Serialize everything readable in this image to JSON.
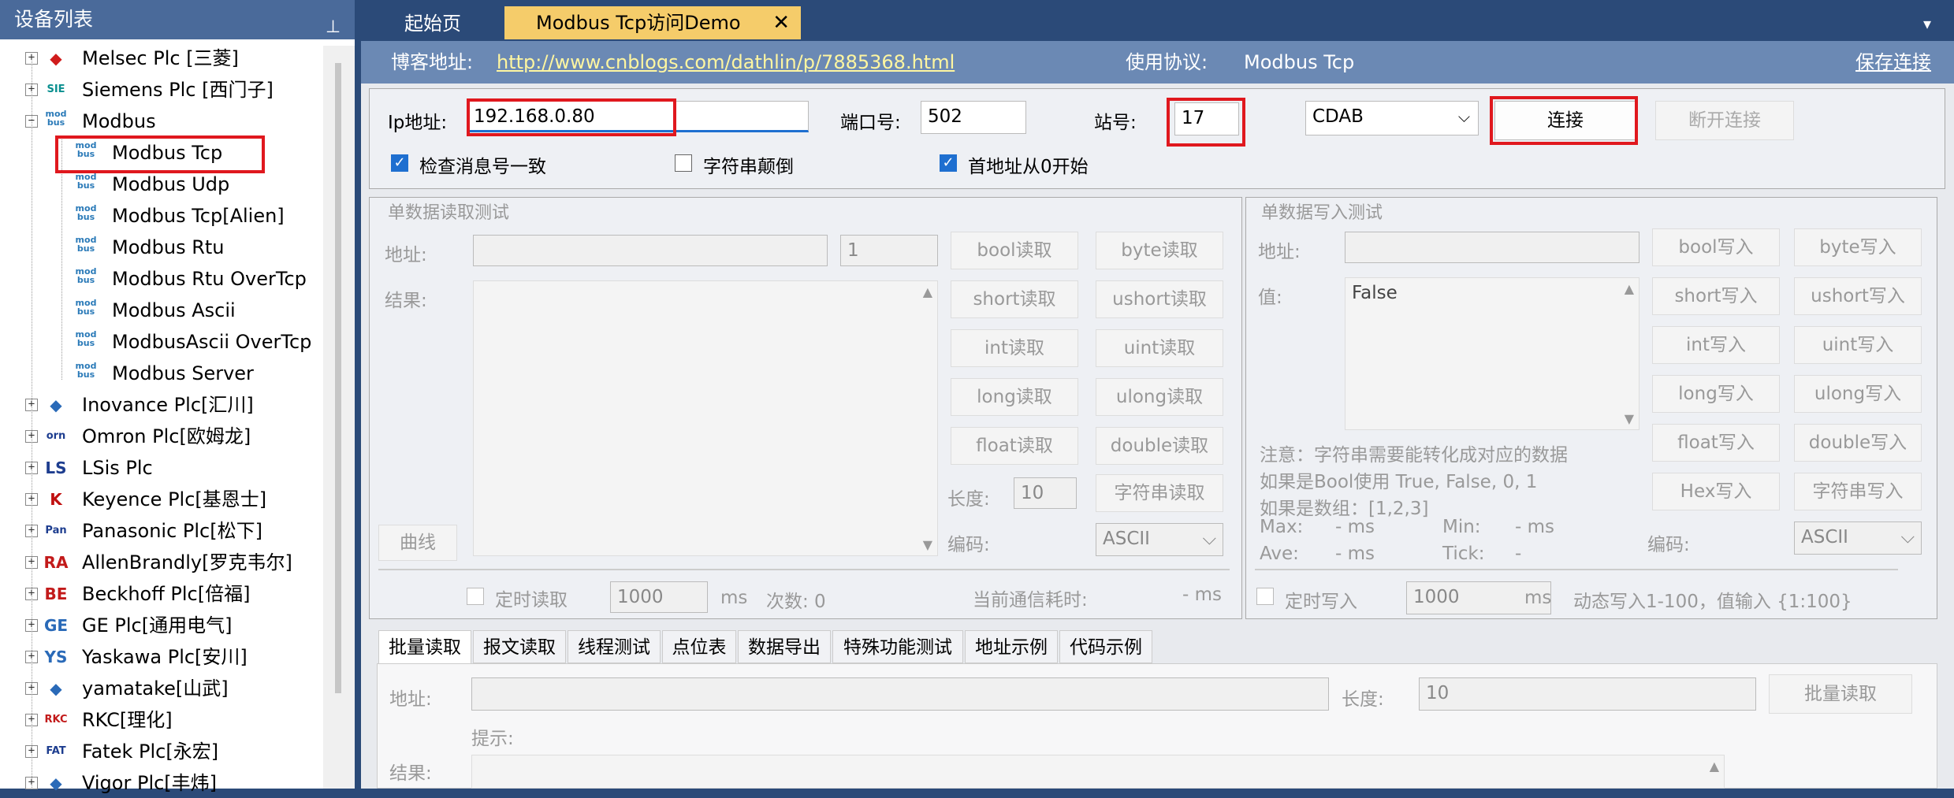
{
  "left_panel": {
    "title": "设备列表",
    "pin_icon": "pin-icon",
    "items": [
      {
        "label": "Melsec Plc [三菱]",
        "icon": "三菱",
        "expander": "+"
      },
      {
        "label": "Siemens Plc [西门子]",
        "icon": "SIE",
        "expander": "+"
      },
      {
        "label": "Modbus",
        "icon": "modbus-icon",
        "expander": "-"
      },
      {
        "label": "Modbus Tcp",
        "icon": "modbus-icon"
      },
      {
        "label": "Modbus Udp",
        "icon": "modbus-icon"
      },
      {
        "label": "Modbus Tcp[Alien]",
        "icon": "modbus-icon"
      },
      {
        "label": "Modbus Rtu",
        "icon": "modbus-icon"
      },
      {
        "label": "Modbus Rtu OverTcp",
        "icon": "modbus-icon"
      },
      {
        "label": "Modbus Ascii",
        "icon": "modbus-icon"
      },
      {
        "label": "ModbusAscii OverTcp",
        "icon": "modbus-icon"
      },
      {
        "label": "Modbus Server",
        "icon": "modbus-icon"
      },
      {
        "label": "Inovance Plc[汇川]",
        "icon": "inovance-icon",
        "expander": "+"
      },
      {
        "label": "Omron Plc[欧姆龙]",
        "icon": "orn",
        "expander": "+"
      },
      {
        "label": "LSis Plc",
        "icon": "LS",
        "expander": "+"
      },
      {
        "label": "Keyence Plc[基恩士]",
        "icon": "K",
        "expander": "+"
      },
      {
        "label": "Panasonic Plc[松下]",
        "icon": "Pan",
        "expander": "+"
      },
      {
        "label": "AllenBrandly[罗克韦尔]",
        "icon": "RA",
        "expander": "+"
      },
      {
        "label": "Beckhoff Plc[倍福]",
        "icon": "BE",
        "expander": "+"
      },
      {
        "label": "GE Plc[通用电气]",
        "icon": "GE",
        "expander": "+"
      },
      {
        "label": "Yaskawa Plc[安川]",
        "icon": "YS",
        "expander": "+"
      },
      {
        "label": "yamatake[山武]",
        "icon": "yamatake-icon",
        "expander": "+"
      },
      {
        "label": "RKC[理化]",
        "icon": "RKC",
        "expander": "+"
      },
      {
        "label": "Fatek Plc[永宏]",
        "icon": "FAT",
        "expander": "+"
      },
      {
        "label": "Vigor Plc[丰炜]",
        "icon": "vigor-icon",
        "expander": "+"
      }
    ]
  },
  "tabs": {
    "start": "起始页",
    "active": "Modbus Tcp访问Demo",
    "close": "✕",
    "menu": "▾"
  },
  "blog": {
    "label": "博客地址:",
    "url": "http://www.cnblogs.com/dathlin/p/7885368.html",
    "protocol_label": "使用协议:",
    "protocol": "Modbus Tcp",
    "save": "保存连接"
  },
  "conn": {
    "ip_label": "Ip地址:",
    "ip": "192.168.0.80",
    "port_label": "端口号:",
    "port": "502",
    "station_label": "站号:",
    "station": "17",
    "format": "CDAB",
    "connect": "连接",
    "disconnect": "断开连接",
    "check1": "检查消息号一致",
    "check2": "字符串颠倒",
    "check3": "首地址从0开始"
  },
  "read": {
    "title": "单数据读取测试",
    "addr_label": "地址:",
    "count": "1",
    "result_label": "结果:",
    "curve": "曲线",
    "buttons": [
      "bool读取",
      "byte读取",
      "short读取",
      "ushort读取",
      "int读取",
      "uint读取",
      "long读取",
      "ulong读取",
      "float读取",
      "double读取"
    ],
    "length_label": "长度:",
    "length": "10",
    "string_read": "字符串读取",
    "encoding_label": "编码:",
    "encoding": "ASCII",
    "timer_label": "定时读取",
    "timer": "1000",
    "ms": "ms",
    "times": "次数: 0",
    "elapsed_label": "当前通信耗时:",
    "elapsed": "- ms"
  },
  "write": {
    "title": "单数据写入测试",
    "addr_label": "地址:",
    "value_label": "值:",
    "value": "False",
    "buttons": [
      "bool写入",
      "byte写入",
      "short写入",
      "ushort写入",
      "int写入",
      "uint写入",
      "long写入",
      "ulong写入",
      "float写入",
      "double写入",
      "Hex写入",
      "字符串写入"
    ],
    "note1": "注意：字符串需要能转化成对应的数据",
    "note2": "如果是Bool使用 True, False, 0, 1",
    "note3": "如果是数组：[1,2,3]",
    "max": "Max:",
    "max_v": "- ms",
    "min": "Min:",
    "min_v": "- ms",
    "ave": "Ave:",
    "ave_v": "- ms",
    "tick": "Tick:",
    "tick_v": "-",
    "encoding_label": "编码:",
    "encoding": "ASCII",
    "timer_label": "定时写入",
    "timer": "1000",
    "ms": "ms",
    "dynamic": "动态写入1-100，值输入 {1:100}"
  },
  "subtabs": [
    "批量读取",
    "报文读取",
    "线程测试",
    "点位表",
    "数据导出",
    "特殊功能测试",
    "地址示例",
    "代码示例"
  ],
  "batch": {
    "addr_label": "地址:",
    "length_label": "长度:",
    "length": "10",
    "read": "批量读取",
    "hint": "提示:",
    "result_label": "结果:"
  }
}
